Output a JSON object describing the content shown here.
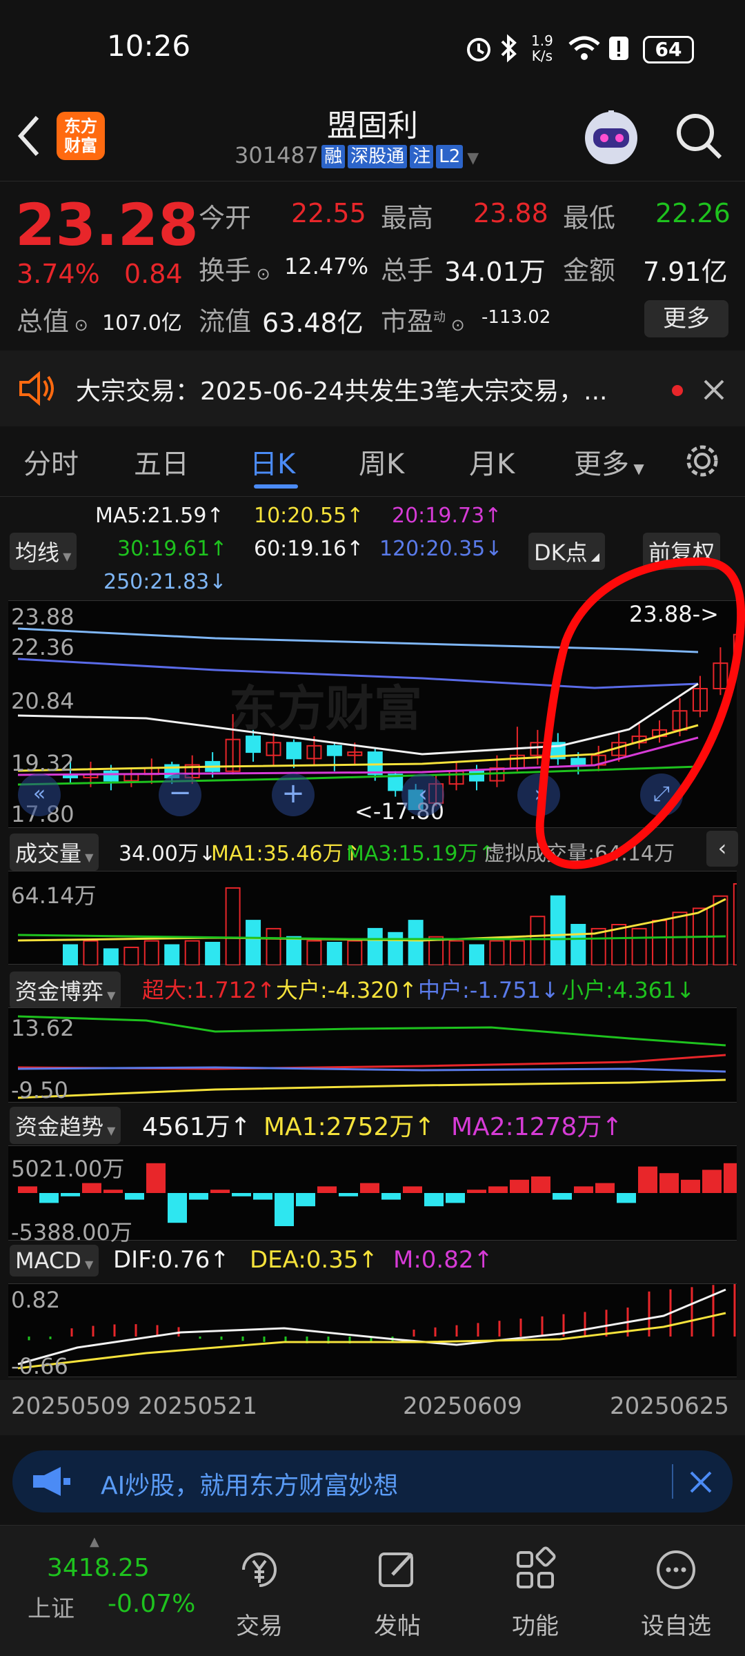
{
  "status": {
    "time": "10:26",
    "speed_top": "1.9",
    "speed_bottom": "K/s",
    "battery": "64"
  },
  "header": {
    "logo_line1": "东方",
    "logo_line2": "财富",
    "title": "盟固利",
    "code": "301487",
    "badges": [
      "融",
      "深股通",
      "注",
      "L2"
    ]
  },
  "quote": {
    "price": "23.28",
    "change_pct": "3.74%",
    "change": "0.84",
    "rows": [
      [
        {
          "label": "今开",
          "value": "22.55",
          "color": "red"
        },
        {
          "label": "最高",
          "value": "23.88",
          "color": "red"
        },
        {
          "label": "最低",
          "value": "22.26",
          "color": "green"
        }
      ],
      [
        {
          "label": "换手",
          "value": "12.47%",
          "color": "white"
        },
        {
          "label": "总手",
          "value": "34.01万",
          "color": "white"
        },
        {
          "label": "金额",
          "value": "7.91亿",
          "color": "white"
        }
      ]
    ],
    "row3": {
      "zongzhi_label": "总值",
      "zongzhi": "107.0亿",
      "liuzhi_label": "流值",
      "liuzhi": "63.48亿",
      "shiying_label": "市盈",
      "shiying_sup": "动",
      "shiying": "-113.02",
      "more": "更多"
    }
  },
  "notice": {
    "text": "大宗交易：2025-06-24共发生3笔大宗交易，..."
  },
  "tabs": [
    "分时",
    "五日",
    "日K",
    "周K",
    "月K",
    "更多"
  ],
  "active_tab": "日K",
  "ma": {
    "btn": "均线",
    "dk": "DK点",
    "fq": "前复权",
    "ma5": "MA5:21.59↑",
    "ma10": "10:20.55↑",
    "ma20": "20:19.73↑",
    "ma30": "30:19.61↑",
    "ma60": "60:19.16↑",
    "ma120": "120:20.35↓",
    "ma250": "250:21.83↓"
  },
  "kline": {
    "y_labels": [
      "23.88",
      "22.36",
      "20.84",
      "19.32",
      "17.80"
    ],
    "high_marker": "23.88->",
    "low_marker": "<-17.80",
    "watermark": "东方财富"
  },
  "volume": {
    "btn": "成交量",
    "v": "34.00万↓",
    "ma1": "MA1:35.46万↑",
    "ma3": "MA3:15.19万↑",
    "virtual": "虚拟成交量:64.14万",
    "y_top": "64.14万"
  },
  "fundflow": {
    "btn": "资金博弈",
    "super": "超大:1.712↑",
    "big": "大户:-4.320↑",
    "mid": "中户:-1.751↓",
    "small": "小户:4.361↓",
    "y_top": "13.62",
    "y_bot": "-9.50"
  },
  "trend": {
    "btn": "资金趋势",
    "v": "4561万↑",
    "ma1": "MA1:2752万↑",
    "ma2": "MA2:1278万↑",
    "y_top": "5021.00万",
    "y_bot": "-5388.00万"
  },
  "macd": {
    "btn": "MACD",
    "dif": "DIF:0.76↑",
    "dea": "DEA:0.35↑",
    "m": "M:0.82↑",
    "y_top": "0.82",
    "y_bot": "-0.66"
  },
  "dates": [
    "20250509",
    "20250521",
    "20250609",
    "20250625"
  ],
  "ad": {
    "text": "AI炒股，就用东方财富妙想"
  },
  "bottom": {
    "index_value": "3418.25",
    "index_name": "上证",
    "index_change": "-0.07%",
    "items": [
      "交易",
      "发帖",
      "功能",
      "设自选"
    ]
  }
}
